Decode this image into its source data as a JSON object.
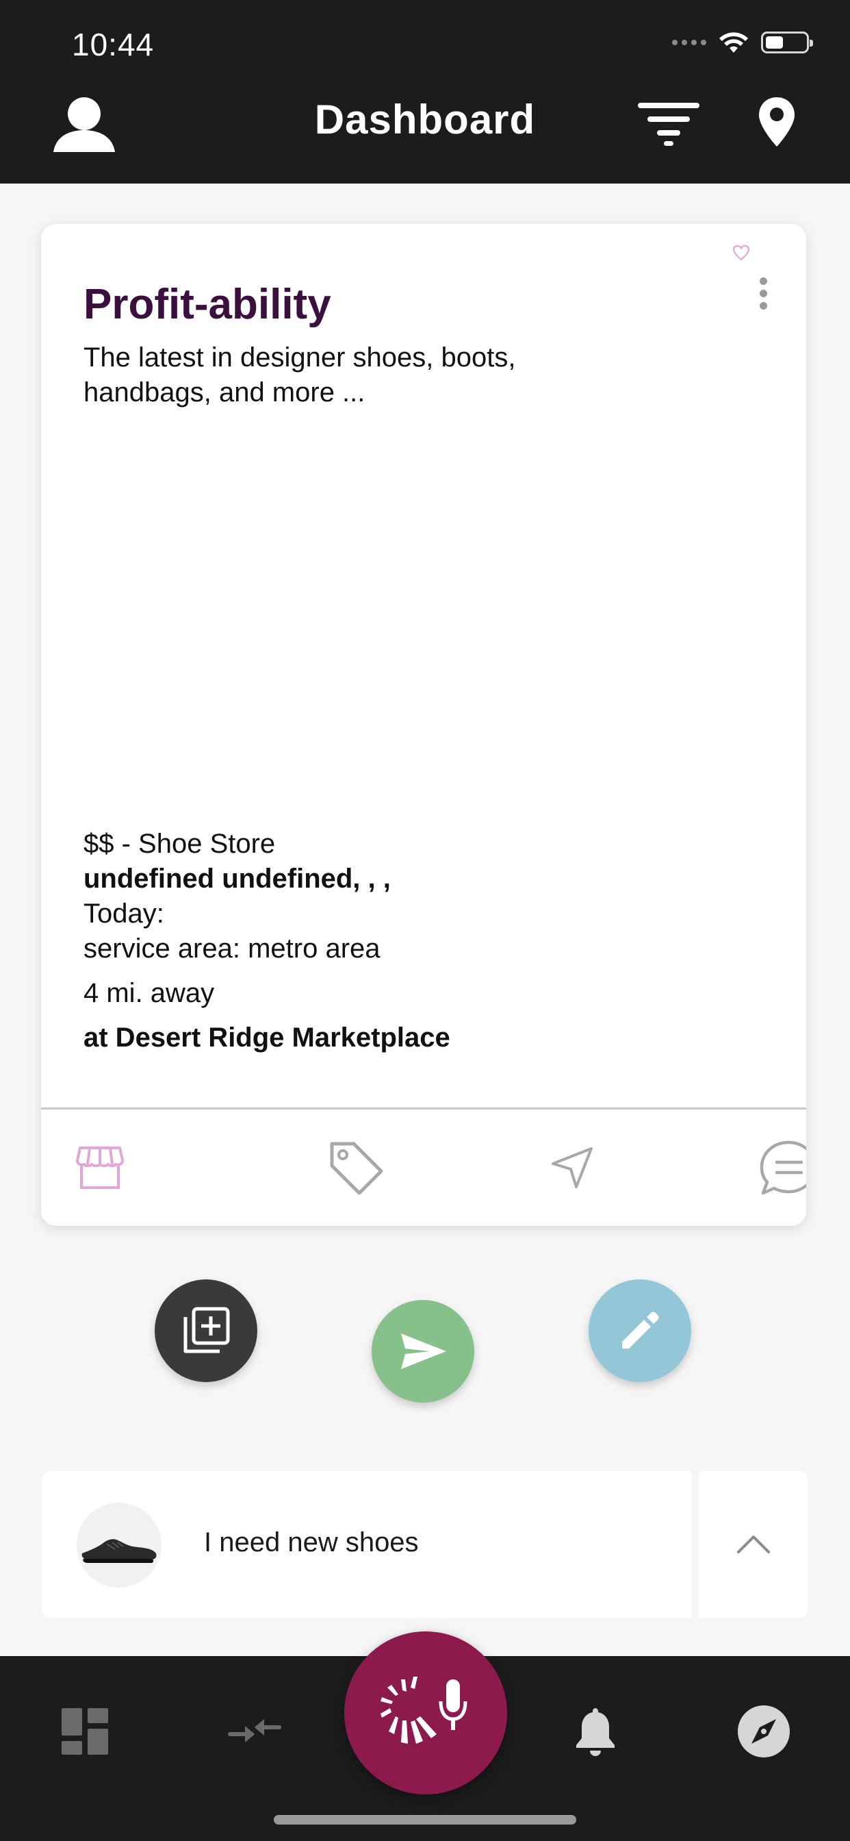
{
  "status": {
    "time": "10:44",
    "battery_level": 0.45
  },
  "header": {
    "title": "Dashboard"
  },
  "card": {
    "title": "Profit-ability",
    "description": "The latest in designer shoes, boots, handbags, and more ...",
    "price_category": "$$ - Shoe Store",
    "address": "undefined undefined, , ,",
    "hours": "Today:",
    "service_area": "service area: metro area",
    "distance": "4 mi. away",
    "location": "at Desert Ridge Marketplace"
  },
  "request": {
    "text": "I need new shoes"
  },
  "colors": {
    "accent_pink": "#e3a6d8",
    "title_purple": "#3b0f3e",
    "mic_fab": "#8c1a4d",
    "send_fab": "#86c08b",
    "edit_fab": "#93c7d8",
    "add_fab": "#3a3a3a",
    "nav_bg": "#1c1c1c"
  },
  "icons": {
    "header_left": "profile-icon",
    "header_filter": "filter-icon",
    "header_location": "location-pin-icon",
    "favorite": "heart-icon",
    "more": "more-vertical-icon",
    "actions": [
      "storefront-icon",
      "tag-icon",
      "navigate-icon",
      "chat-icon"
    ],
    "fabs": [
      "add-to-collection-icon",
      "send-icon",
      "edit-icon"
    ],
    "nav": [
      "dashboard-icon",
      "exchange-icon",
      "mic-icon",
      "bell-icon",
      "compass-icon"
    ]
  }
}
